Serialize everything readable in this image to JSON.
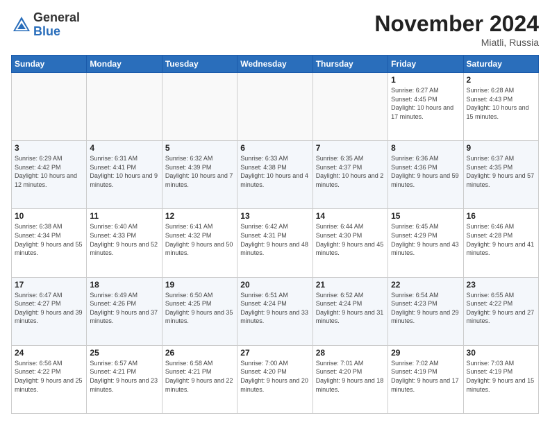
{
  "header": {
    "logo_general": "General",
    "logo_blue": "Blue",
    "month_title": "November 2024",
    "subtitle": "Miatli, Russia"
  },
  "days_of_week": [
    "Sunday",
    "Monday",
    "Tuesday",
    "Wednesday",
    "Thursday",
    "Friday",
    "Saturday"
  ],
  "weeks": [
    [
      {
        "day": "",
        "info": ""
      },
      {
        "day": "",
        "info": ""
      },
      {
        "day": "",
        "info": ""
      },
      {
        "day": "",
        "info": ""
      },
      {
        "day": "",
        "info": ""
      },
      {
        "day": "1",
        "info": "Sunrise: 6:27 AM\nSunset: 4:45 PM\nDaylight: 10 hours and 17 minutes."
      },
      {
        "day": "2",
        "info": "Sunrise: 6:28 AM\nSunset: 4:43 PM\nDaylight: 10 hours and 15 minutes."
      }
    ],
    [
      {
        "day": "3",
        "info": "Sunrise: 6:29 AM\nSunset: 4:42 PM\nDaylight: 10 hours and 12 minutes."
      },
      {
        "day": "4",
        "info": "Sunrise: 6:31 AM\nSunset: 4:41 PM\nDaylight: 10 hours and 9 minutes."
      },
      {
        "day": "5",
        "info": "Sunrise: 6:32 AM\nSunset: 4:39 PM\nDaylight: 10 hours and 7 minutes."
      },
      {
        "day": "6",
        "info": "Sunrise: 6:33 AM\nSunset: 4:38 PM\nDaylight: 10 hours and 4 minutes."
      },
      {
        "day": "7",
        "info": "Sunrise: 6:35 AM\nSunset: 4:37 PM\nDaylight: 10 hours and 2 minutes."
      },
      {
        "day": "8",
        "info": "Sunrise: 6:36 AM\nSunset: 4:36 PM\nDaylight: 9 hours and 59 minutes."
      },
      {
        "day": "9",
        "info": "Sunrise: 6:37 AM\nSunset: 4:35 PM\nDaylight: 9 hours and 57 minutes."
      }
    ],
    [
      {
        "day": "10",
        "info": "Sunrise: 6:38 AM\nSunset: 4:34 PM\nDaylight: 9 hours and 55 minutes."
      },
      {
        "day": "11",
        "info": "Sunrise: 6:40 AM\nSunset: 4:33 PM\nDaylight: 9 hours and 52 minutes."
      },
      {
        "day": "12",
        "info": "Sunrise: 6:41 AM\nSunset: 4:32 PM\nDaylight: 9 hours and 50 minutes."
      },
      {
        "day": "13",
        "info": "Sunrise: 6:42 AM\nSunset: 4:31 PM\nDaylight: 9 hours and 48 minutes."
      },
      {
        "day": "14",
        "info": "Sunrise: 6:44 AM\nSunset: 4:30 PM\nDaylight: 9 hours and 45 minutes."
      },
      {
        "day": "15",
        "info": "Sunrise: 6:45 AM\nSunset: 4:29 PM\nDaylight: 9 hours and 43 minutes."
      },
      {
        "day": "16",
        "info": "Sunrise: 6:46 AM\nSunset: 4:28 PM\nDaylight: 9 hours and 41 minutes."
      }
    ],
    [
      {
        "day": "17",
        "info": "Sunrise: 6:47 AM\nSunset: 4:27 PM\nDaylight: 9 hours and 39 minutes."
      },
      {
        "day": "18",
        "info": "Sunrise: 6:49 AM\nSunset: 4:26 PM\nDaylight: 9 hours and 37 minutes."
      },
      {
        "day": "19",
        "info": "Sunrise: 6:50 AM\nSunset: 4:25 PM\nDaylight: 9 hours and 35 minutes."
      },
      {
        "day": "20",
        "info": "Sunrise: 6:51 AM\nSunset: 4:24 PM\nDaylight: 9 hours and 33 minutes."
      },
      {
        "day": "21",
        "info": "Sunrise: 6:52 AM\nSunset: 4:24 PM\nDaylight: 9 hours and 31 minutes."
      },
      {
        "day": "22",
        "info": "Sunrise: 6:54 AM\nSunset: 4:23 PM\nDaylight: 9 hours and 29 minutes."
      },
      {
        "day": "23",
        "info": "Sunrise: 6:55 AM\nSunset: 4:22 PM\nDaylight: 9 hours and 27 minutes."
      }
    ],
    [
      {
        "day": "24",
        "info": "Sunrise: 6:56 AM\nSunset: 4:22 PM\nDaylight: 9 hours and 25 minutes."
      },
      {
        "day": "25",
        "info": "Sunrise: 6:57 AM\nSunset: 4:21 PM\nDaylight: 9 hours and 23 minutes."
      },
      {
        "day": "26",
        "info": "Sunrise: 6:58 AM\nSunset: 4:21 PM\nDaylight: 9 hours and 22 minutes."
      },
      {
        "day": "27",
        "info": "Sunrise: 7:00 AM\nSunset: 4:20 PM\nDaylight: 9 hours and 20 minutes."
      },
      {
        "day": "28",
        "info": "Sunrise: 7:01 AM\nSunset: 4:20 PM\nDaylight: 9 hours and 18 minutes."
      },
      {
        "day": "29",
        "info": "Sunrise: 7:02 AM\nSunset: 4:19 PM\nDaylight: 9 hours and 17 minutes."
      },
      {
        "day": "30",
        "info": "Sunrise: 7:03 AM\nSunset: 4:19 PM\nDaylight: 9 hours and 15 minutes."
      }
    ]
  ]
}
